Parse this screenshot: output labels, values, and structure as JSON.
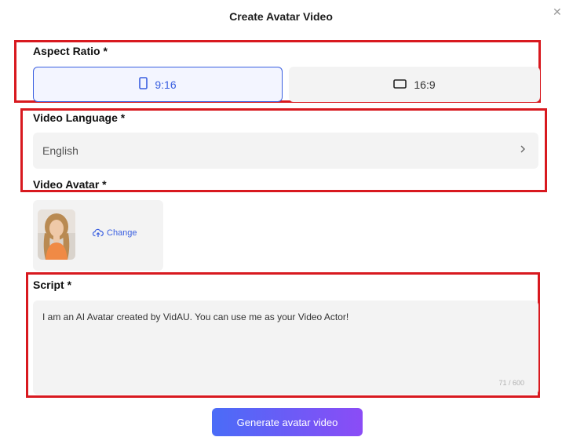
{
  "dialog": {
    "title": "Create Avatar Video",
    "close_icon": "close-icon"
  },
  "aspect_ratio": {
    "label": "Aspect Ratio *",
    "options": [
      {
        "label": "9:16",
        "icon": "portrait-icon",
        "selected": true
      },
      {
        "label": "16:9",
        "icon": "landscape-icon",
        "selected": false
      }
    ]
  },
  "video_language": {
    "label": "Video Language *",
    "value": "English",
    "icon": "chevron-right-icon"
  },
  "video_avatar": {
    "label": "Video Avatar *",
    "change_label": "Change",
    "change_icon": "cloud-upload-icon"
  },
  "script": {
    "label": "Script *",
    "value": "I am an AI Avatar created by VidAU. You can use me as your Video Actor!",
    "counter": "71 / 600"
  },
  "generate_button": {
    "label": "Generate avatar video"
  },
  "colors": {
    "accent": "#3a5fe0",
    "highlight_border": "#d8191f",
    "button_gradient_start": "#4a6cf7",
    "button_gradient_end": "#8b4cf6",
    "field_bg": "#f3f3f3"
  }
}
